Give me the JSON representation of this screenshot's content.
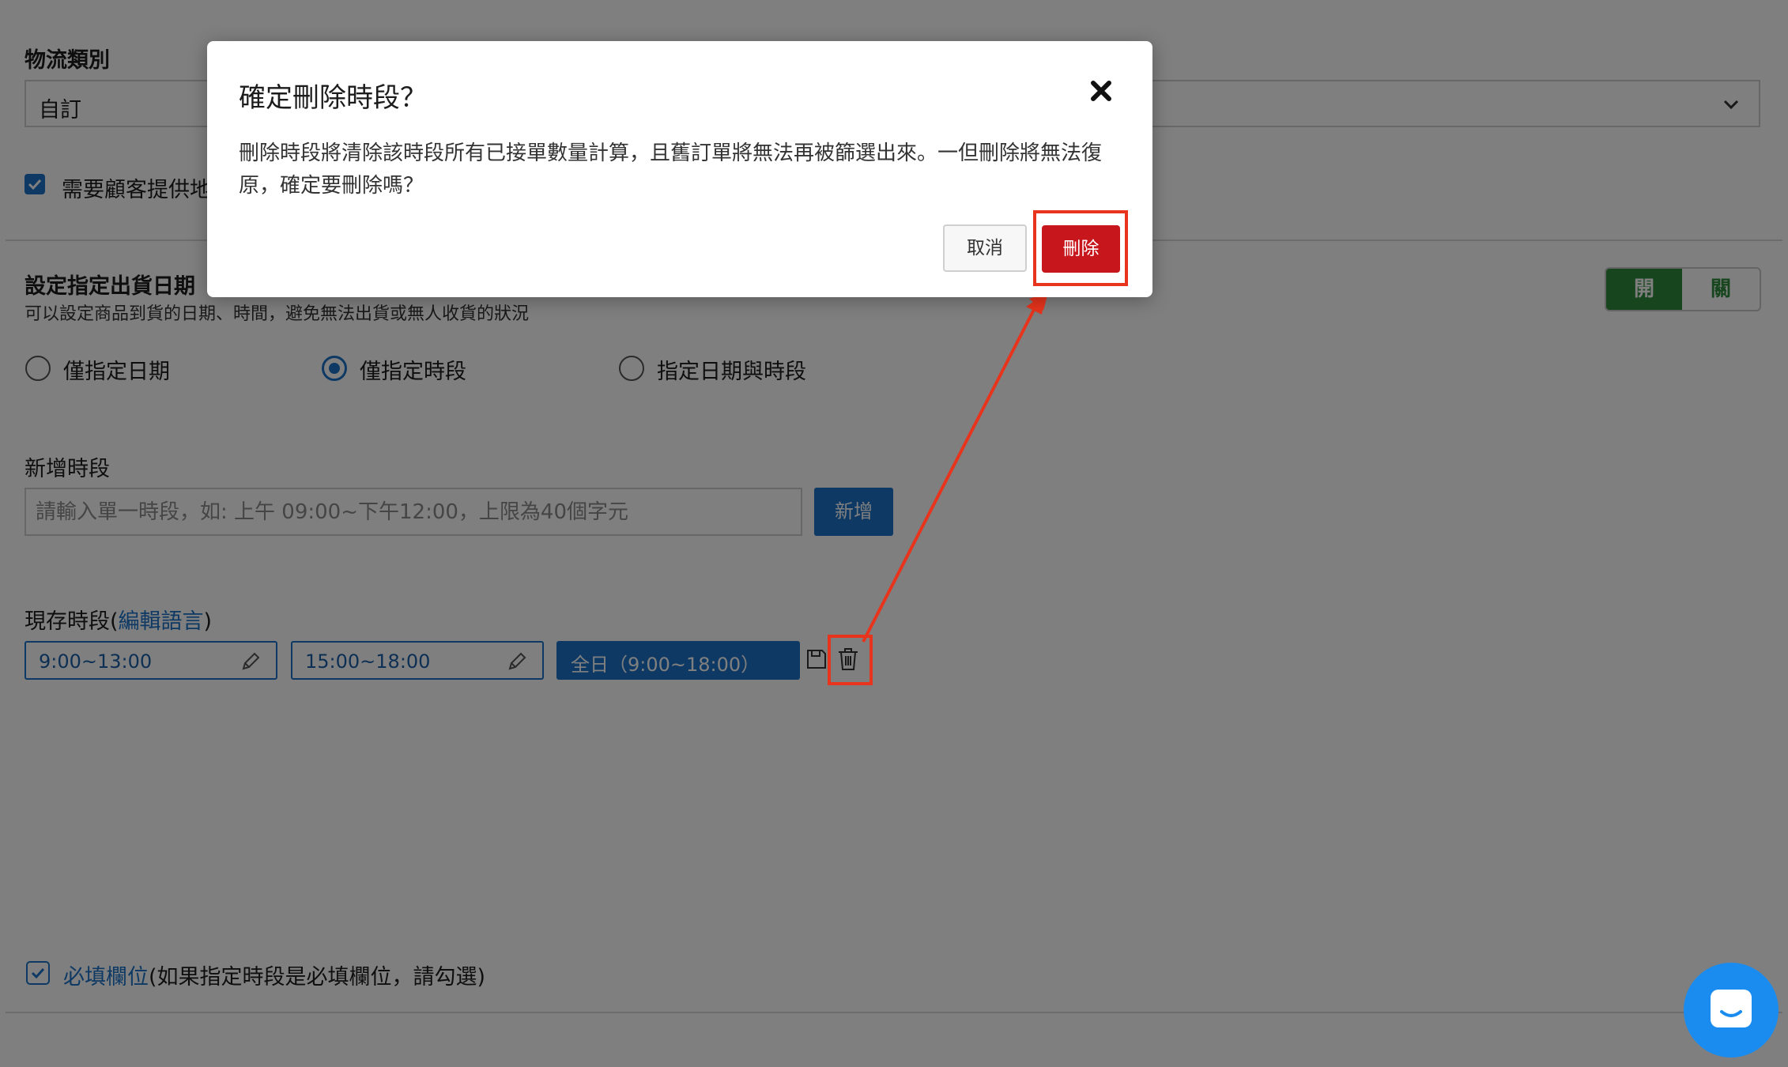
{
  "form": {
    "logistics_type_label": "物流類別",
    "logistics_type_value": "自訂",
    "require_address_label": "需要顧客提供地址",
    "delivery_date_title": "設定指定出貨日期",
    "delivery_date_desc": "可以設定商品到貨的日期、時間，避免無法出貨或無人收貨的狀況",
    "toggle": {
      "on_label": "開",
      "off_label": "關"
    },
    "radio_options": [
      {
        "label": "僅指定日期",
        "selected": false
      },
      {
        "label": "僅指定時段",
        "selected": true
      },
      {
        "label": "指定日期與時段",
        "selected": false
      }
    ],
    "add_slot_label": "新增時段",
    "add_slot_placeholder": "請輸入單一時段，如: 上午 09:00~下午12:00，上限為40個字元",
    "add_button": "新增",
    "existing_slots_label": "現存時段(",
    "edit_language_link": "編輯語言",
    "existing_slots_label_end": ")",
    "slots": [
      "9:00~13:00",
      "15:00~18:00"
    ],
    "editing_slot": "全日（9:00~18:00）",
    "required_link": "必填欄位",
    "required_note": "(如果指定時段是必填欄位，請勾選)"
  },
  "dialog": {
    "title": "確定刪除時段？",
    "body": "刪除時段將清除該時段所有已接單數量計算，且舊訂單將無法再被篩選出來。一但刪除將無法復原，確定要刪除嗎？",
    "cancel_label": "取消",
    "delete_label": "刪除"
  },
  "colors": {
    "primary": "#1a73c8",
    "danger": "#c8161d",
    "toggle_on": "#2e8b3a",
    "annotation": "#e8341c",
    "chat": "#1a8cf0"
  }
}
